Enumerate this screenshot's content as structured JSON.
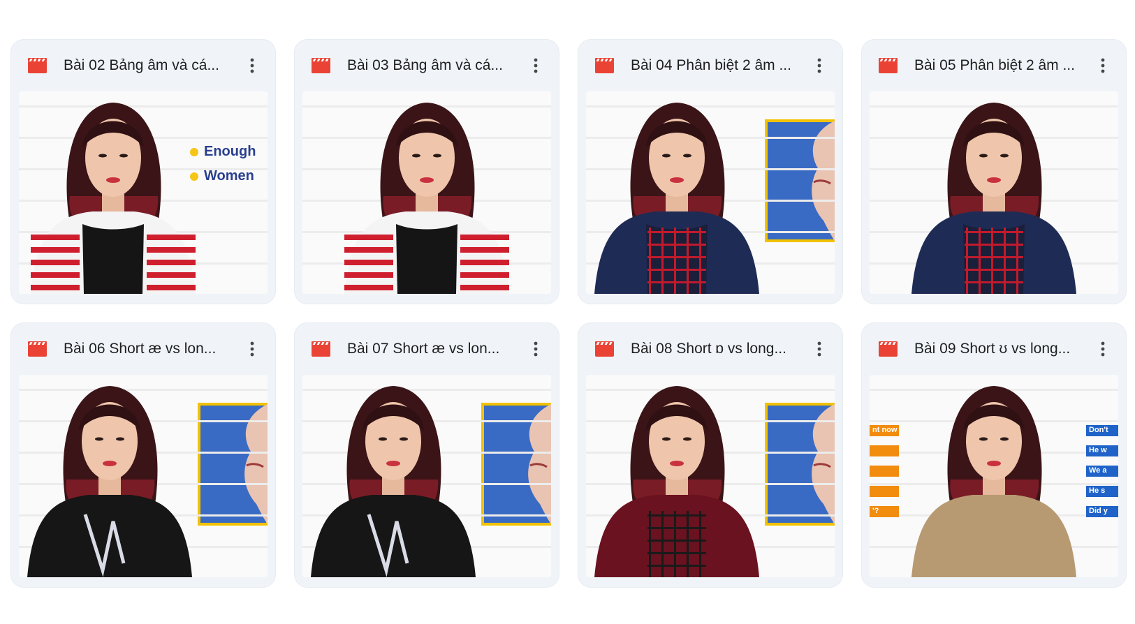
{
  "files": [
    {
      "title": "Bài 02 Bảng âm và cá...",
      "icon": "video-file-icon",
      "outfit": "red-white-stripes",
      "overlay": "word-list"
    },
    {
      "title": "Bài 03 Bảng âm và cá...",
      "icon": "video-file-icon",
      "outfit": "red-white-stripes",
      "overlay": "none"
    },
    {
      "title": "Bài 04 Phân biệt 2 âm ...",
      "icon": "video-file-icon",
      "outfit": "plaid-navy",
      "overlay": "mouth-diagram"
    },
    {
      "title": "Bài 05 Phân biệt 2 âm ...",
      "icon": "video-file-icon",
      "outfit": "plaid-navy",
      "overlay": "none"
    },
    {
      "title": "Bài 06 Short æ vs lon...",
      "icon": "video-file-icon",
      "outfit": "black-tshirt",
      "overlay": "mouth-diagram"
    },
    {
      "title": "Bài 07 Short æ vs lon...",
      "icon": "video-file-icon",
      "outfit": "black-tshirt",
      "overlay": "mouth-diagram"
    },
    {
      "title": "Bài 08 Short ɒ vs long...",
      "icon": "video-file-icon",
      "outfit": "red-plaid-shirt",
      "overlay": "mouth-diagram"
    },
    {
      "title": "Bài 09 Short ʊ vs long...",
      "icon": "video-file-icon",
      "outfit": "tan-tshirt",
      "overlay": "sentence-chips"
    }
  ],
  "overlays": {
    "word_list": [
      "Enough",
      "Women"
    ],
    "left_chips": [
      "nt now",
      "",
      "",
      "",
      "'?"
    ],
    "right_chips": [
      "Don't",
      "He w",
      "We a",
      "He s",
      "Did y"
    ]
  },
  "colors": {
    "card_bg": "#f0f4f9",
    "video_icon": "#ea4335",
    "diagram_blue": "#3a6bc4",
    "diagram_border": "#f2c200",
    "chip_orange": "#f28c0f",
    "chip_blue": "#1f63c9"
  }
}
